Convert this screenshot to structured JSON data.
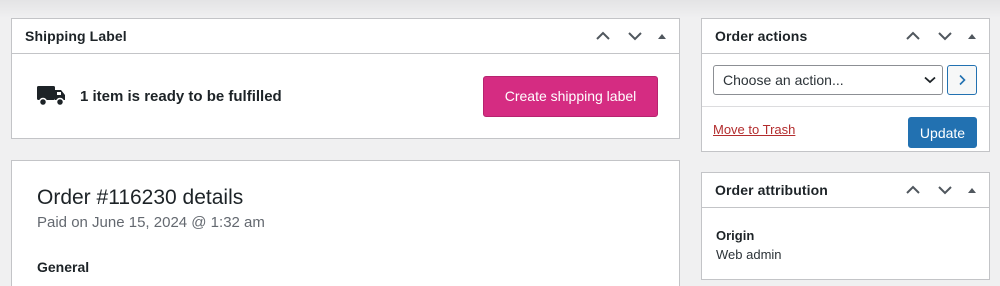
{
  "shipping": {
    "title": "Shipping Label",
    "message": "1 item is ready to be fulfilled",
    "create_label_button": "Create shipping label"
  },
  "order_details": {
    "title": "Order #116230 details",
    "paid_on": "Paid on June 15, 2024 @ 1:32 am",
    "section_general": "General"
  },
  "order_actions": {
    "title": "Order actions",
    "select": {
      "selected": "Choose an action..."
    },
    "go_button_glyph": "›",
    "trash_link": "Move to Trash",
    "update_button": "Update"
  },
  "order_attribution": {
    "title": "Order attribution",
    "origin_label": "Origin",
    "origin_value": "Web admin"
  },
  "colors": {
    "pink_button": "#d52c82",
    "primary_blue": "#2271b1",
    "trash_red": "#b32d2e",
    "background": "#f0f0f1"
  },
  "icons": {
    "truck": "truck-icon",
    "move_up": "chevron-up-icon",
    "move_down": "chevron-down-icon",
    "toggle": "triangle-up-icon",
    "dropdown": "chevron-down-icon",
    "go": "chevron-right-icon"
  }
}
